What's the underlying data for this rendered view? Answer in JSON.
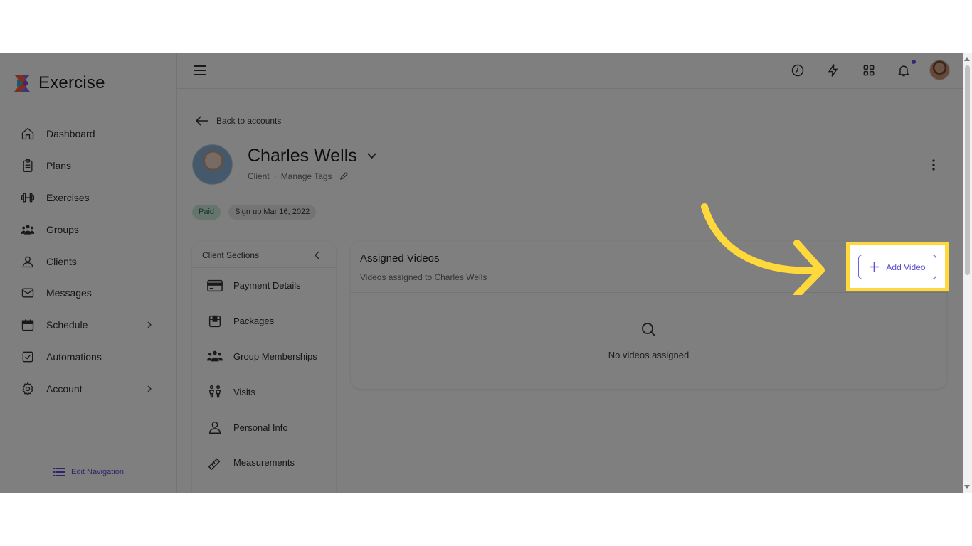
{
  "app": {
    "name": "Exercise"
  },
  "sidebar": {
    "items": [
      {
        "label": "Dashboard",
        "icon": "home-icon"
      },
      {
        "label": "Plans",
        "icon": "clipboard-icon"
      },
      {
        "label": "Exercises",
        "icon": "dumbbell-icon"
      },
      {
        "label": "Groups",
        "icon": "users-icon"
      },
      {
        "label": "Clients",
        "icon": "user-icon"
      },
      {
        "label": "Messages",
        "icon": "mail-icon"
      },
      {
        "label": "Schedule",
        "icon": "calendar-icon"
      },
      {
        "label": "Automations",
        "icon": "checkbox-icon"
      },
      {
        "label": "Account",
        "icon": "gear-icon"
      }
    ],
    "edit_navigation": "Edit Navigation"
  },
  "topbar": {
    "icons": [
      "menu-icon",
      "clock-icon",
      "lightning-icon",
      "grid-icon",
      "bell-icon",
      "avatar"
    ]
  },
  "profile": {
    "back_label": "Back to accounts",
    "name": "Charles Wells",
    "role": "Client",
    "separator": "·",
    "manage_tags": "Manage Tags",
    "status_pill": "Paid",
    "signup_pill": "Sign up Mar 16, 2022"
  },
  "client_sections": {
    "title": "Client Sections",
    "items": [
      {
        "label": "Payment Details",
        "icon": "credit-card-icon"
      },
      {
        "label": "Packages",
        "icon": "package-icon"
      },
      {
        "label": "Group Memberships",
        "icon": "group-icon"
      },
      {
        "label": "Visits",
        "icon": "visits-icon"
      },
      {
        "label": "Personal Info",
        "icon": "user-icon"
      },
      {
        "label": "Measurements",
        "icon": "ruler-icon"
      }
    ]
  },
  "assigned_videos": {
    "title": "Assigned Videos",
    "subtitle": "Videos assigned to Charles Wells",
    "empty_text": "No videos assigned",
    "add_button": "Add Video"
  },
  "colors": {
    "accent": "#5a4fcf",
    "highlight": "#ffd83c",
    "paid_bg": "#cdebdc"
  }
}
